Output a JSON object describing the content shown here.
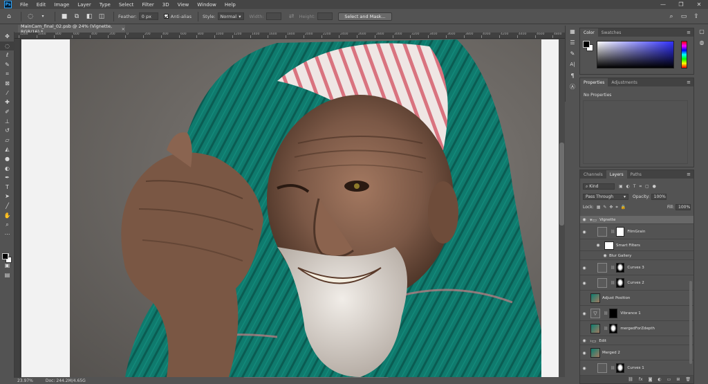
{
  "menubar": {
    "logo": "Ps",
    "items": [
      "File",
      "Edit",
      "Image",
      "Layer",
      "Type",
      "Select",
      "Filter",
      "3D",
      "View",
      "Window",
      "Help"
    ],
    "window_controls": [
      "—",
      "❐",
      "✕"
    ]
  },
  "options": {
    "feather_label": "Feather:",
    "feather_value": "0 px",
    "antialias_label": "Anti-alias",
    "style_label": "Style:",
    "style_value": "Normal",
    "width_label": "Width:",
    "height_label": "Height:",
    "select_mask_label": "Select and Mask..."
  },
  "document": {
    "tab_title": "MainCam_final_02.psb @ 24% (Vignette, RGB/16) *",
    "close": "×"
  },
  "ruler": {
    "labels": [
      "1200",
      "1000",
      "800",
      "600",
      "400",
      "200",
      "0",
      "200",
      "400",
      "600",
      "800",
      "1000",
      "1200",
      "1400",
      "1600",
      "1800",
      "2000",
      "2200",
      "2400",
      "2600",
      "2800",
      "3000",
      "3200",
      "3400",
      "3600",
      "3800",
      "4000",
      "4200",
      "4400",
      "4600",
      "4800"
    ]
  },
  "status": {
    "zoom": "23.97%",
    "doc": "Doc: 244.2M/4.65G"
  },
  "color_panel": {
    "tabs": [
      "Color",
      "Swatches"
    ],
    "fg": "#000000",
    "bg": "#ffffff",
    "hue": "#3131ff"
  },
  "properties_panel": {
    "tabs": [
      "Properties",
      "Adjustments"
    ],
    "content": "No Properties"
  },
  "layers_panel": {
    "tabs": [
      "Channels",
      "Layers",
      "Paths"
    ],
    "filter_kind": "Kind",
    "blend_mode": "Pass Through",
    "opacity_label": "Opacity:",
    "opacity_value": "100%",
    "lock_label": "Lock:",
    "fill_label": "Fill:",
    "fill_value": "100%",
    "layers": [
      {
        "name": "Vignette",
        "type": "group",
        "visible": true,
        "selected": true
      },
      {
        "name": "FilmGrain",
        "type": "smart",
        "visible": true,
        "selected": false
      },
      {
        "name": "Smart Filters",
        "type": "filters",
        "visible": true,
        "selected": false
      },
      {
        "name": "Blur Gallery",
        "type": "filter-item",
        "visible": true,
        "selected": false
      },
      {
        "name": "Curves 3",
        "type": "curves",
        "visible": true,
        "selected": false
      },
      {
        "name": "Curves 2",
        "type": "curves",
        "visible": true,
        "selected": false
      },
      {
        "name": "Adjust Position",
        "type": "photo",
        "visible": false,
        "selected": false
      },
      {
        "name": "Vibrance 1",
        "type": "vibrance",
        "visible": true,
        "selected": false
      },
      {
        "name": "mergedForZdepth",
        "type": "photo-mask",
        "visible": false,
        "selected": false
      },
      {
        "name": "Edit",
        "type": "folder",
        "visible": true,
        "selected": false
      },
      {
        "name": "Merged 2",
        "type": "photo",
        "visible": true,
        "selected": false
      },
      {
        "name": "Curves 1",
        "type": "curves-blob",
        "visible": true,
        "selected": false
      }
    ]
  }
}
